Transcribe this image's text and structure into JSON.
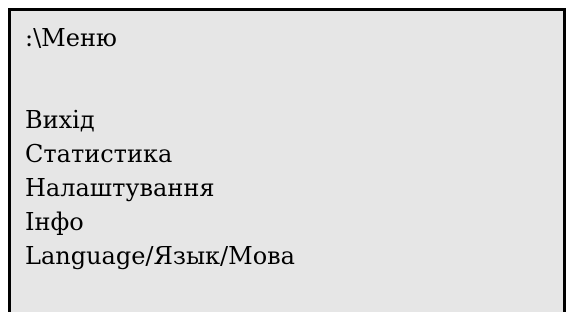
{
  "screen": {
    "path": ":\\Меню"
  },
  "menu": {
    "items": [
      {
        "label": "Вихід"
      },
      {
        "label": "Статистика"
      },
      {
        "label": "Налаштування"
      },
      {
        "label": "Інфо"
      },
      {
        "label": "Language/Язык/Мова"
      }
    ]
  },
  "colors": {
    "background": "#e6e6e6",
    "border": "#000000",
    "text": "#000000"
  }
}
